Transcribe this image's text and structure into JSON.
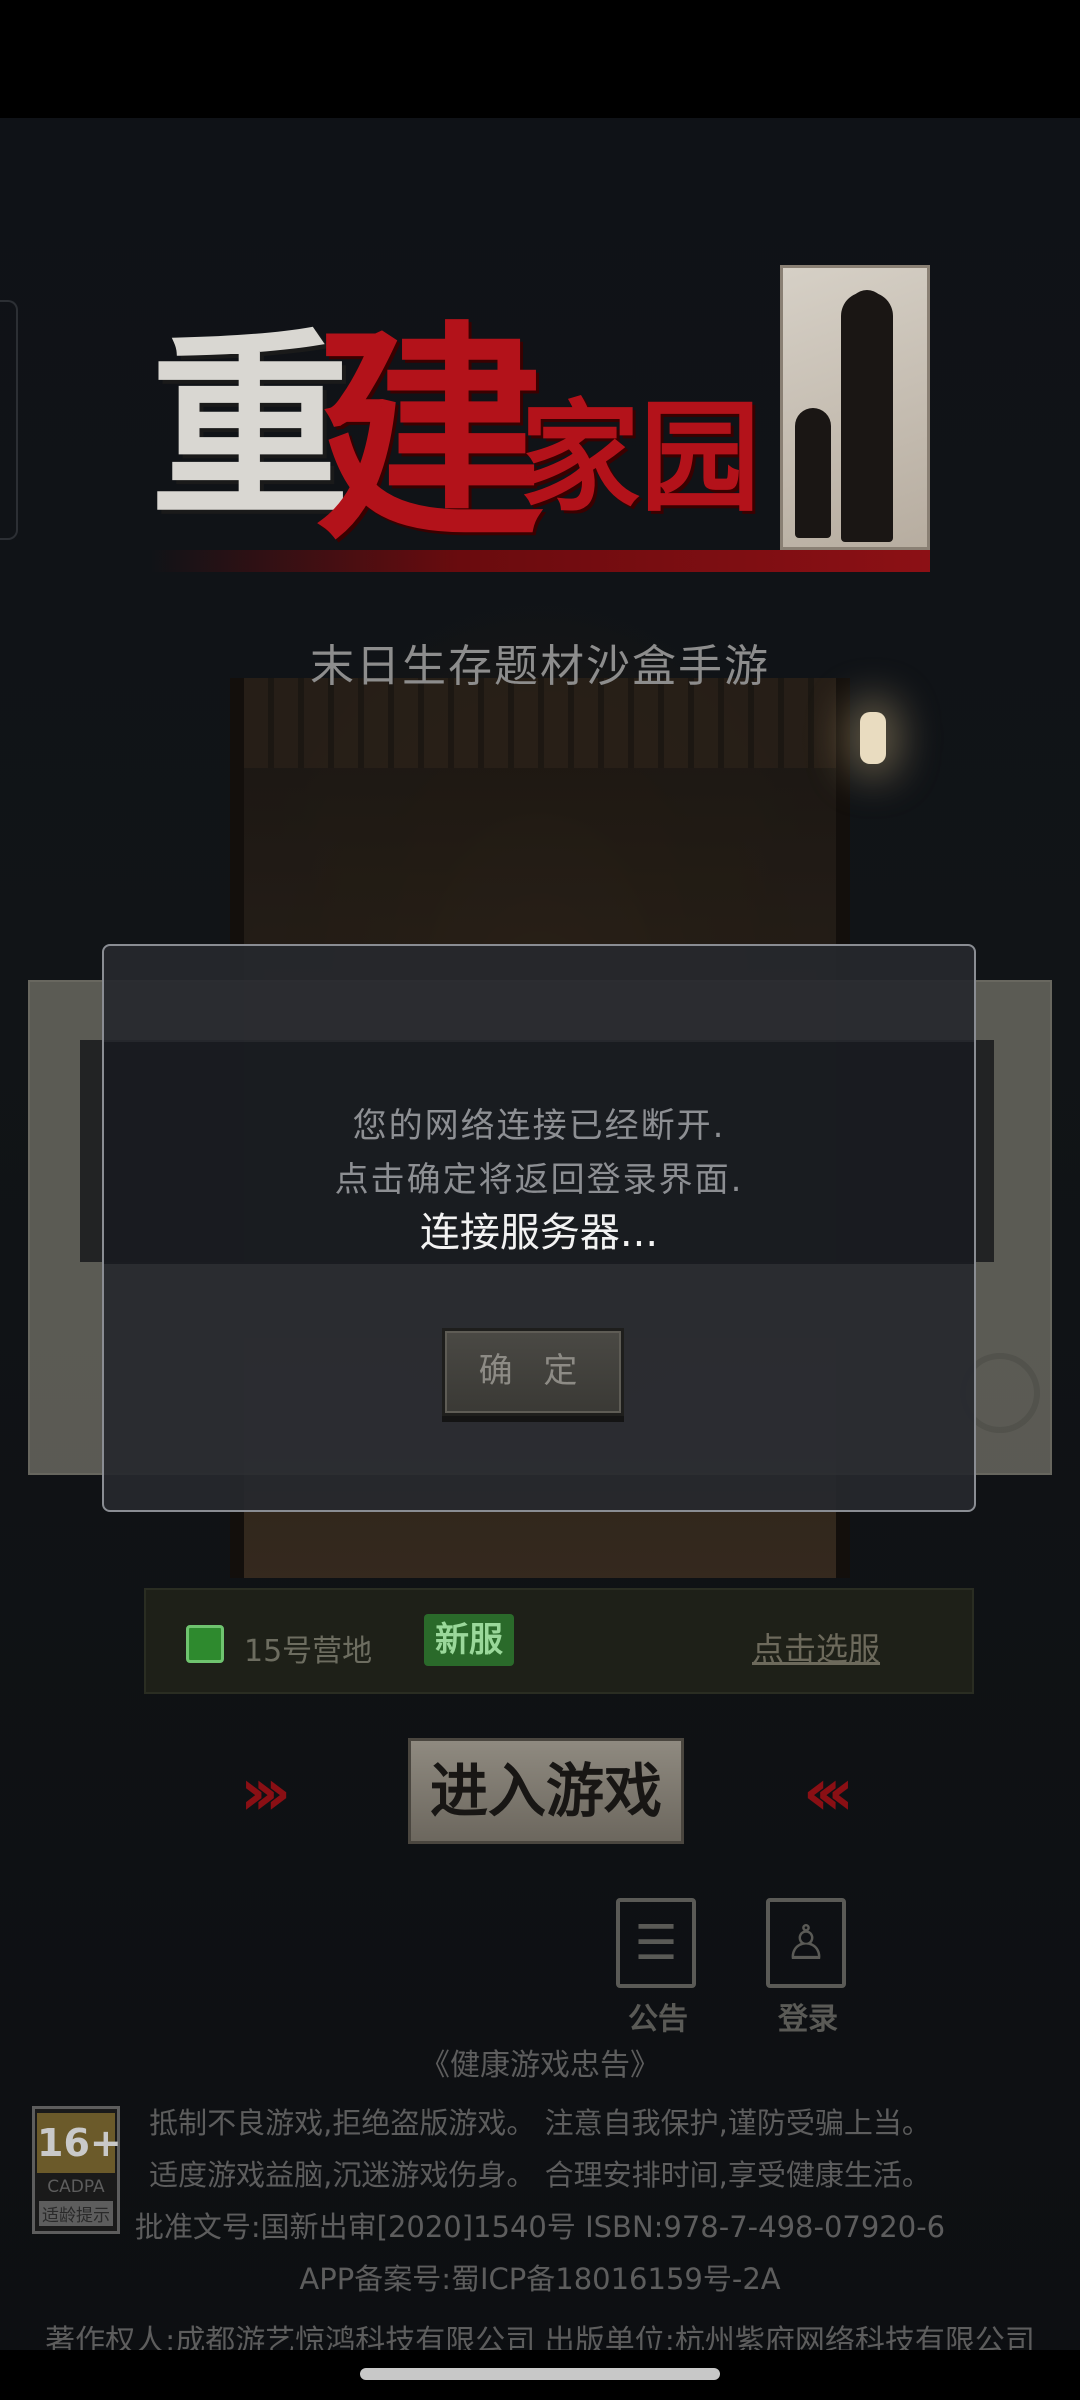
{
  "game": {
    "title_chars": [
      "重",
      "建",
      "家园"
    ],
    "subtitle": "末日生存题材沙盒手游"
  },
  "server": {
    "name": "15号营地",
    "badge": "新服",
    "select_label": "点击选服"
  },
  "enter": {
    "label": "进入游戏",
    "left_arrows": "›››",
    "right_arrows": "‹‹‹"
  },
  "icons": {
    "notice_label": "公告",
    "login_label": "登录"
  },
  "health": {
    "title": "《健康游戏忠告》",
    "line1": "抵制不良游戏,拒绝盗版游戏。 注意自我保护,谨防受骗上当。",
    "line2": "适度游戏益脑,沉迷游戏伤身。 合理安排时间,享受健康生活。",
    "line3": "批准文号:国新出审[2020]1540号    ISBN:978-7-498-07920-6",
    "line4": "APP备案号:蜀ICP备18016159号-2A",
    "copyright": "著作权人:成都游艺惊鸿科技有限公司 出版单位:杭州紫府网络科技有限公司"
  },
  "age_rating": {
    "age": "16+",
    "org": "CADPA",
    "tip": "适龄提示"
  },
  "dialog": {
    "message_line1": "您的网络连接已经断开.",
    "message_line2": "点击确定将返回登录界面.",
    "status": "连接服务器...",
    "confirm_label": "确 定"
  }
}
